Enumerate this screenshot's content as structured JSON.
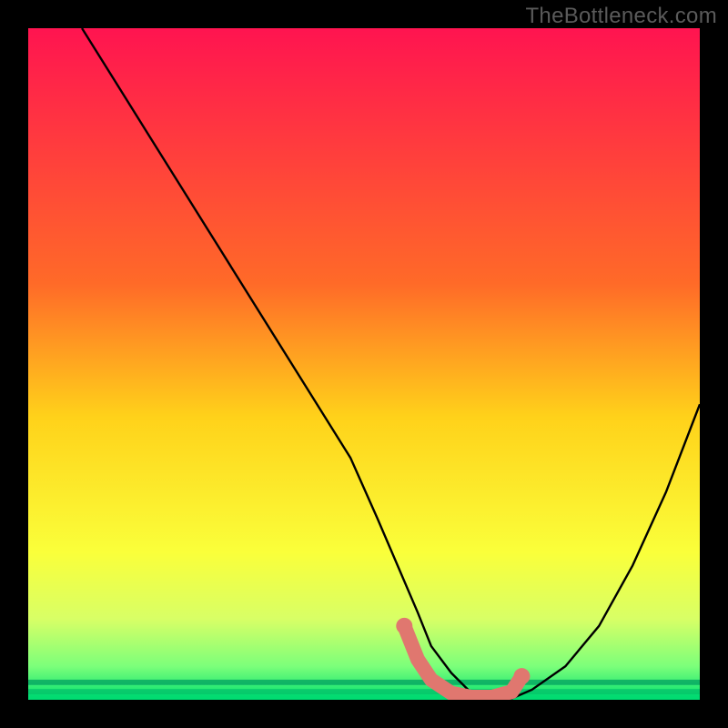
{
  "watermark": "TheBottleneck.com",
  "chart_data": {
    "type": "line",
    "title": "",
    "xlabel": "",
    "ylabel": "",
    "xlim": [
      0,
      100
    ],
    "ylim": [
      0,
      100
    ],
    "gradient_stops": [
      {
        "offset": 0,
        "color": "#ff1450"
      },
      {
        "offset": 38,
        "color": "#ff6a28"
      },
      {
        "offset": 58,
        "color": "#ffd21a"
      },
      {
        "offset": 78,
        "color": "#faff3a"
      },
      {
        "offset": 88,
        "color": "#d8ff66"
      },
      {
        "offset": 95,
        "color": "#7cff7a"
      },
      {
        "offset": 100,
        "color": "#00e070"
      }
    ],
    "series": [
      {
        "name": "black-curve",
        "color": "#000000",
        "width": 2.4,
        "x": [
          8,
          13,
          18,
          23,
          28,
          33,
          38,
          43,
          48,
          52,
          55,
          58,
          60,
          63,
          66,
          69,
          72,
          75,
          80,
          85,
          90,
          95,
          100
        ],
        "y": [
          100,
          92,
          84,
          76,
          68,
          60,
          52,
          44,
          36,
          27,
          20,
          13,
          8,
          4,
          1,
          0.2,
          0.2,
          1.5,
          5,
          11,
          20,
          31,
          44
        ]
      },
      {
        "name": "pink-overlay",
        "color": "#e0776f",
        "width": 16,
        "linecap": "round",
        "x": [
          56,
          58,
          60,
          63,
          66,
          69,
          72,
          73.5
        ],
        "y": [
          11,
          6,
          3,
          1,
          0.4,
          0.4,
          1.2,
          3.5
        ]
      }
    ],
    "bottom_stripes": [
      {
        "y": 97.0,
        "h": 0.8,
        "color": "#00a060"
      },
      {
        "y": 98.4,
        "h": 0.8,
        "color": "#00c06a"
      },
      {
        "y": 99.2,
        "h": 1.2,
        "color": "#00d872"
      }
    ]
  }
}
